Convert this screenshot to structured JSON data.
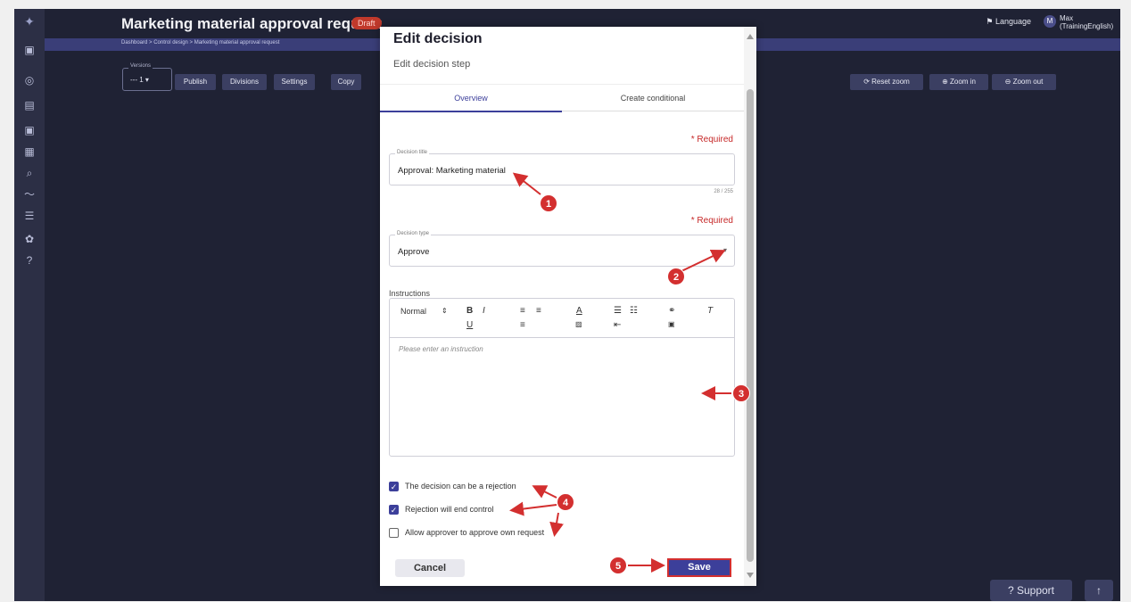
{
  "app": {
    "title": "Marketing material approval request",
    "status": "Draft",
    "language": "Language",
    "user_initial": "M",
    "user_name": "Max (TrainingEnglish)"
  },
  "breadcrumb": "Dashboard   >   Control design   >   Marketing material approval request",
  "toolbar": {
    "versions_label": "Versions",
    "versions_value": "--- 1 ▾",
    "buttons": [
      "Publish",
      "Divisions",
      "Settings",
      "Copy"
    ],
    "zoom": [
      "Reset zoom",
      "Zoom in",
      "Zoom out"
    ]
  },
  "footer": {
    "support": "Support",
    "top": "↑"
  },
  "modal": {
    "title": "Edit decision",
    "subtitle": "Edit decision step",
    "tabs": [
      "Overview",
      "Create conditional"
    ],
    "required": "* Required",
    "decision_title_label": "Decision title",
    "decision_title_value": "Approval: Marketing material",
    "decision_title_count": "28 / 255",
    "decision_type_label": "Decision type",
    "decision_type_value": "Approve",
    "instructions_label": "Instructions",
    "editor_format": "Normal",
    "editor_placeholder": "Please enter an instruction",
    "checks": [
      {
        "label": "The decision can be a rejection",
        "checked": true
      },
      {
        "label": "Rejection will end control",
        "checked": true
      },
      {
        "label": "Allow approver to approve own request",
        "checked": false
      }
    ],
    "cancel": "Cancel",
    "save": "Save"
  },
  "annotations": [
    "1",
    "2",
    "3",
    "4",
    "5"
  ],
  "colors": {
    "accent": "#3c3f9a",
    "annotation": "#d32f2f",
    "required": "#c62828"
  }
}
